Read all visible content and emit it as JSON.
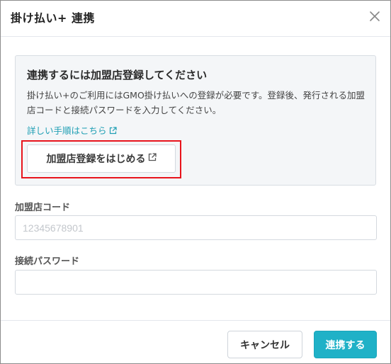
{
  "dialog": {
    "title": "掛け払い+ 連携",
    "close_icon": "close-icon"
  },
  "notice": {
    "title": "連携するには加盟店登録してください",
    "body": "掛け払い+のご利用にはGMO掛け払いへの登録が必要です。登録後、発行される加盟店コードと接続パスワードを入力してください。",
    "link_label": "詳しい手順はこちら",
    "link_icon": "external-link-icon",
    "button_label": "加盟店登録をはじめる",
    "button_icon": "external-link-icon",
    "highlight_color": "#e8141c"
  },
  "form": {
    "merchant_code": {
      "label": "加盟店コード",
      "placeholder": "12345678901",
      "value": ""
    },
    "password": {
      "label": "接続パスワード",
      "placeholder": "",
      "value": ""
    }
  },
  "footer": {
    "cancel_label": "キャンセル",
    "submit_label": "連携する",
    "accent_color": "#1fb1c7"
  }
}
